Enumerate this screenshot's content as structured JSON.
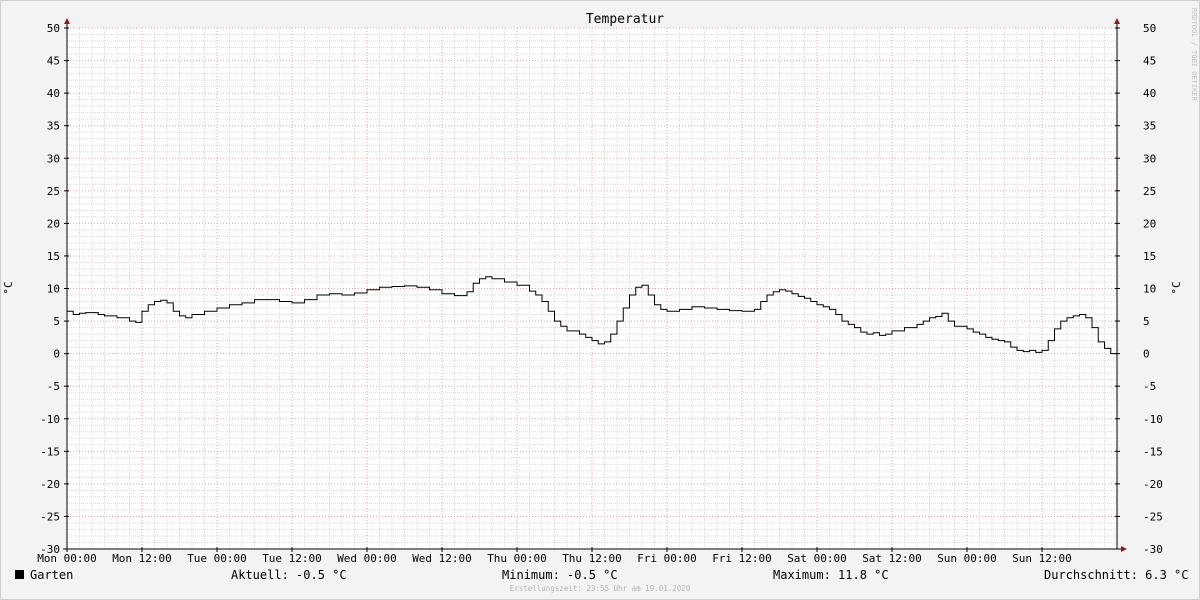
{
  "chart_data": {
    "type": "line",
    "title": "Temperatur",
    "ylabel_left": "°C",
    "ylabel_right": "°C",
    "ylim": [
      -30,
      50
    ],
    "y_ticks": [
      50,
      45,
      40,
      35,
      30,
      25,
      20,
      15,
      10,
      5,
      0,
      -5,
      -10,
      -15,
      -20,
      -25,
      -30
    ],
    "x_tick_labels": [
      "Mon 00:00",
      "Mon 12:00",
      "Tue 00:00",
      "Tue 12:00",
      "Wed 00:00",
      "Wed 12:00",
      "Thu 00:00",
      "Thu 12:00",
      "Fri 00:00",
      "Fri 12:00",
      "Sat 00:00",
      "Sat 12:00",
      "Sun 00:00",
      "Sun 12:00"
    ],
    "x_unit": "hours since Mon 00:00",
    "x_range_hours": [
      0,
      168
    ],
    "grid": true,
    "line_style": "step",
    "series": [
      {
        "name": "Garten",
        "color": "#000000",
        "points": [
          [
            0,
            6.5
          ],
          [
            1,
            6.0
          ],
          [
            2,
            6.2
          ],
          [
            3,
            6.3
          ],
          [
            5,
            6.0
          ],
          [
            6,
            5.8
          ],
          [
            8,
            5.5
          ],
          [
            10,
            5.0
          ],
          [
            11,
            4.8
          ],
          [
            12,
            6.5
          ],
          [
            13,
            7.5
          ],
          [
            14,
            8.0
          ],
          [
            15,
            8.2
          ],
          [
            16,
            7.8
          ],
          [
            17,
            6.5
          ],
          [
            18,
            5.8
          ],
          [
            19,
            5.5
          ],
          [
            20,
            6.0
          ],
          [
            22,
            6.5
          ],
          [
            24,
            7.0
          ],
          [
            26,
            7.5
          ],
          [
            28,
            7.8
          ],
          [
            30,
            8.3
          ],
          [
            32,
            8.3
          ],
          [
            34,
            8.0
          ],
          [
            36,
            7.8
          ],
          [
            38,
            8.3
          ],
          [
            40,
            9.0
          ],
          [
            42,
            9.2
          ],
          [
            44,
            9.0
          ],
          [
            46,
            9.3
          ],
          [
            48,
            9.8
          ],
          [
            50,
            10.2
          ],
          [
            52,
            10.3
          ],
          [
            54,
            10.4
          ],
          [
            56,
            10.2
          ],
          [
            58,
            9.8
          ],
          [
            60,
            9.2
          ],
          [
            62,
            8.9
          ],
          [
            64,
            9.5
          ],
          [
            65,
            10.8
          ],
          [
            66,
            11.5
          ],
          [
            67,
            11.8
          ],
          [
            68,
            11.5
          ],
          [
            70,
            11.0
          ],
          [
            72,
            10.5
          ],
          [
            74,
            9.6
          ],
          [
            75,
            9.0
          ],
          [
            76,
            8.0
          ],
          [
            77,
            6.5
          ],
          [
            78,
            5.0
          ],
          [
            79,
            4.2
          ],
          [
            80,
            3.5
          ],
          [
            82,
            3.0
          ],
          [
            83,
            2.5
          ],
          [
            84,
            2.0
          ],
          [
            85,
            1.5
          ],
          [
            86,
            1.8
          ],
          [
            87,
            3.0
          ],
          [
            88,
            5.0
          ],
          [
            89,
            7.0
          ],
          [
            90,
            9.0
          ],
          [
            91,
            10.2
          ],
          [
            92,
            10.5
          ],
          [
            93,
            9.0
          ],
          [
            94,
            7.5
          ],
          [
            95,
            6.8
          ],
          [
            96,
            6.5
          ],
          [
            98,
            6.8
          ],
          [
            100,
            7.2
          ],
          [
            102,
            7.0
          ],
          [
            104,
            6.8
          ],
          [
            106,
            6.6
          ],
          [
            108,
            6.5
          ],
          [
            110,
            6.8
          ],
          [
            111,
            8.0
          ],
          [
            112,
            9.0
          ],
          [
            113,
            9.5
          ],
          [
            114,
            9.8
          ],
          [
            115,
            9.6
          ],
          [
            116,
            9.2
          ],
          [
            117,
            8.8
          ],
          [
            118,
            8.5
          ],
          [
            119,
            8.0
          ],
          [
            120,
            7.5
          ],
          [
            121,
            7.2
          ],
          [
            122,
            6.8
          ],
          [
            123,
            6.0
          ],
          [
            124,
            5.0
          ],
          [
            125,
            4.5
          ],
          [
            126,
            4.0
          ],
          [
            127,
            3.3
          ],
          [
            128,
            3.0
          ],
          [
            129,
            3.2
          ],
          [
            130,
            2.8
          ],
          [
            131,
            3.0
          ],
          [
            132,
            3.5
          ],
          [
            134,
            4.0
          ],
          [
            136,
            4.5
          ],
          [
            137,
            5.0
          ],
          [
            138,
            5.5
          ],
          [
            139,
            5.7
          ],
          [
            140,
            6.2
          ],
          [
            141,
            5.0
          ],
          [
            142,
            4.2
          ],
          [
            144,
            3.8
          ],
          [
            145,
            3.3
          ],
          [
            146,
            3.0
          ],
          [
            147,
            2.5
          ],
          [
            148,
            2.2
          ],
          [
            149,
            2.0
          ],
          [
            150,
            1.8
          ],
          [
            151,
            1.0
          ],
          [
            152,
            0.5
          ],
          [
            153,
            0.3
          ],
          [
            154,
            0.5
          ],
          [
            155,
            0.2
          ],
          [
            156,
            0.5
          ],
          [
            157,
            2.0
          ],
          [
            158,
            3.8
          ],
          [
            159,
            5.0
          ],
          [
            160,
            5.5
          ],
          [
            161,
            5.8
          ],
          [
            162,
            6.0
          ],
          [
            163,
            5.5
          ],
          [
            164,
            4.0
          ],
          [
            165,
            1.8
          ],
          [
            166,
            0.8
          ],
          [
            167,
            0.0
          ],
          [
            168,
            -0.5
          ]
        ]
      }
    ]
  },
  "legend": {
    "series_name": "Garten",
    "aktuell": "Aktuell: -0.5 °C",
    "minimum": "Minimum: -0.5 °C",
    "maximum": "Maximum: 11.8 °C",
    "durchschnitt": "Durchschnitt: 6.3 °C"
  },
  "watermark": "RRDTOOL / TOBI OETIKER",
  "footer": "Erstellungszeit: 23:55 Uhr am 19.01.2020",
  "colors": {
    "canvas": "#ffffff",
    "background": "#f3f3f3",
    "major_grid": "#e8a4a4",
    "minor_grid": "#dadada",
    "axis": "#000000",
    "arrow": "#8b1a1a",
    "line": "#000000"
  }
}
